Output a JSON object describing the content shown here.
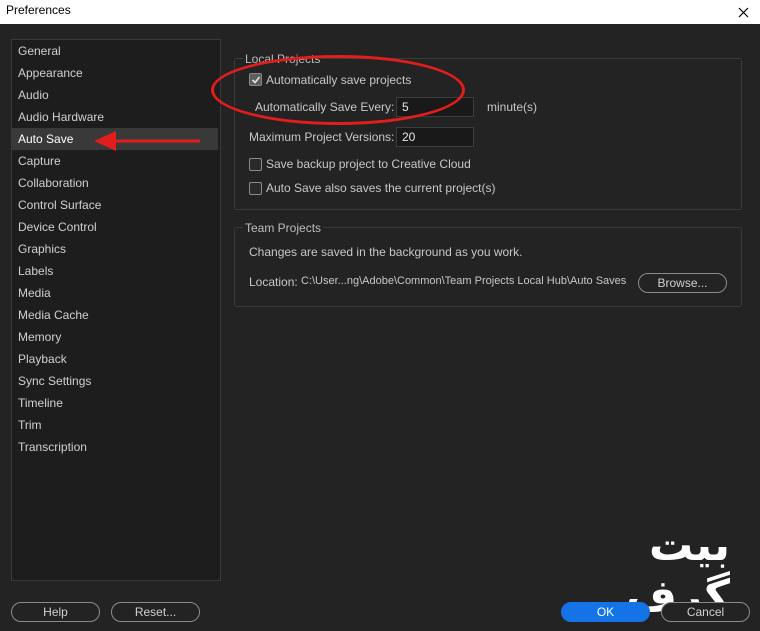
{
  "window": {
    "title": "Preferences"
  },
  "sidebar": {
    "items": [
      {
        "label": "General"
      },
      {
        "label": "Appearance"
      },
      {
        "label": "Audio"
      },
      {
        "label": "Audio Hardware"
      },
      {
        "label": "Auto Save",
        "selected": true
      },
      {
        "label": "Capture"
      },
      {
        "label": "Collaboration"
      },
      {
        "label": "Control Surface"
      },
      {
        "label": "Device Control"
      },
      {
        "label": "Graphics"
      },
      {
        "label": "Labels"
      },
      {
        "label": "Media"
      },
      {
        "label": "Media Cache"
      },
      {
        "label": "Memory"
      },
      {
        "label": "Playback"
      },
      {
        "label": "Sync Settings"
      },
      {
        "label": "Timeline"
      },
      {
        "label": "Trim"
      },
      {
        "label": "Transcription"
      }
    ]
  },
  "local_projects": {
    "title": "Local Projects",
    "auto_save_label": "Automatically save projects",
    "auto_save_checked": true,
    "save_every_label": "Automatically Save Every:",
    "save_every_value": "5",
    "save_every_unit": "minute(s)",
    "max_versions_label": "Maximum Project Versions:",
    "max_versions_value": "20",
    "backup_cloud_label": "Save backup project to Creative Cloud",
    "backup_cloud_checked": false,
    "save_current_label": "Auto Save also saves the current project(s)",
    "save_current_checked": false
  },
  "team_projects": {
    "title": "Team Projects",
    "description": "Changes are saved in the background as you work.",
    "location_label": "Location:",
    "location_value": "C:\\User...ng\\Adobe\\Common\\Team Projects Local Hub\\Auto Saves",
    "browse_label": "Browse..."
  },
  "footer": {
    "help_label": "Help",
    "reset_label": "Reset...",
    "ok_label": "OK",
    "cancel_label": "Cancel"
  },
  "watermark": {
    "text": "بیت گرف"
  },
  "colors": {
    "accent": "#1473e6",
    "annotation": "#e11d1d",
    "background": "#232323",
    "sidebar_selected": "#393939"
  },
  "icons": {
    "close": "close-icon",
    "checkmark": "checkmark-icon"
  }
}
